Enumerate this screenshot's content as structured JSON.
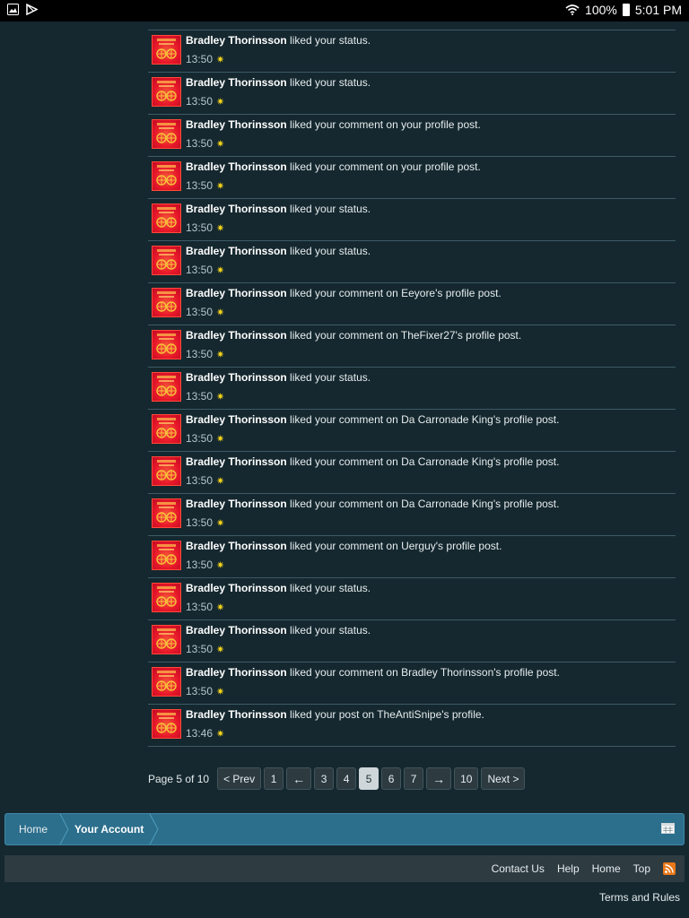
{
  "status_bar": {
    "battery": "100%",
    "time": "5:01 PM"
  },
  "alerts": [
    {
      "user": "Bradley Thorinsson",
      "action": "liked your status.",
      "time": "13:50"
    },
    {
      "user": "Bradley Thorinsson",
      "action": "liked your status.",
      "time": "13:50"
    },
    {
      "user": "Bradley Thorinsson",
      "action": "liked your comment on your profile post.",
      "time": "13:50"
    },
    {
      "user": "Bradley Thorinsson",
      "action": "liked your comment on your profile post.",
      "time": "13:50"
    },
    {
      "user": "Bradley Thorinsson",
      "action": "liked your status.",
      "time": "13:50"
    },
    {
      "user": "Bradley Thorinsson",
      "action": "liked your status.",
      "time": "13:50"
    },
    {
      "user": "Bradley Thorinsson",
      "action": "liked your comment on Eeyore's profile post.",
      "time": "13:50"
    },
    {
      "user": "Bradley Thorinsson",
      "action": "liked your comment on TheFixer27's profile post.",
      "time": "13:50"
    },
    {
      "user": "Bradley Thorinsson",
      "action": "liked your status.",
      "time": "13:50"
    },
    {
      "user": "Bradley Thorinsson",
      "action": "liked your comment on Da Carronade King's profile post.",
      "time": "13:50"
    },
    {
      "user": "Bradley Thorinsson",
      "action": "liked your comment on Da Carronade King's profile post.",
      "time": "13:50"
    },
    {
      "user": "Bradley Thorinsson",
      "action": "liked your comment on Da Carronade King's profile post.",
      "time": "13:50"
    },
    {
      "user": "Bradley Thorinsson",
      "action": "liked your comment on Uerguy's profile post.",
      "time": "13:50"
    },
    {
      "user": "Bradley Thorinsson",
      "action": "liked your status.",
      "time": "13:50"
    },
    {
      "user": "Bradley Thorinsson",
      "action": "liked your status.",
      "time": "13:50"
    },
    {
      "user": "Bradley Thorinsson",
      "action": "liked your comment on Bradley Thorinsson's profile post.",
      "time": "13:50"
    },
    {
      "user": "Bradley Thorinsson",
      "action": "liked your post on TheAntiSnipe's profile.",
      "time": "13:46"
    }
  ],
  "pagination": {
    "label": "Page 5 of 10",
    "prev": "< Prev",
    "next": "Next >",
    "left_arrow": "←",
    "right_arrow": "→",
    "pages": [
      "1",
      "3",
      "4",
      "5",
      "6",
      "7",
      "10"
    ],
    "current": "5"
  },
  "breadcrumb": {
    "home": "Home",
    "current": "Your Account"
  },
  "footer": {
    "links": [
      "Contact Us",
      "Help",
      "Home",
      "Top"
    ],
    "terms": "Terms and Rules"
  },
  "colors": {
    "background": "#15282f",
    "breadcrumb": "#2c6f8d",
    "star": "#f2d31b",
    "avatar": "#e8182a"
  }
}
